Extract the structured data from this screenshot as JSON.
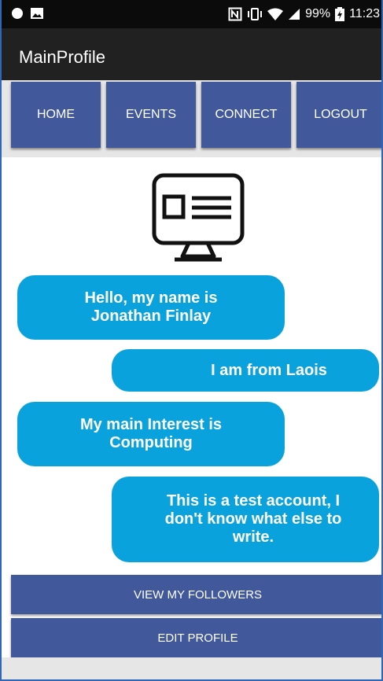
{
  "status_bar": {
    "battery": "99%",
    "time": "11:23"
  },
  "app_bar": {
    "title": "MainProfile"
  },
  "nav_tabs": [
    {
      "label": "HOME"
    },
    {
      "label": "EVENTS"
    },
    {
      "label": "CONNECT"
    },
    {
      "label": "LOGOUT"
    }
  ],
  "profile": {
    "icon": "monitor-profile-icon",
    "bubbles": [
      "Hello, my name is Jonathan Finlay",
      "I am from Laois",
      "My main Interest is Computing",
      "This is a test account, I don't know what else to write."
    ]
  },
  "actions": {
    "followers_label": "VIEW MY FOLLOWERS",
    "edit_label": "EDIT PROFILE"
  },
  "colors": {
    "tab_blue": "#41589a",
    "bubble_blue": "#0aa2dc",
    "app_bar": "#212121",
    "status_bar": "#0b0b0b"
  }
}
